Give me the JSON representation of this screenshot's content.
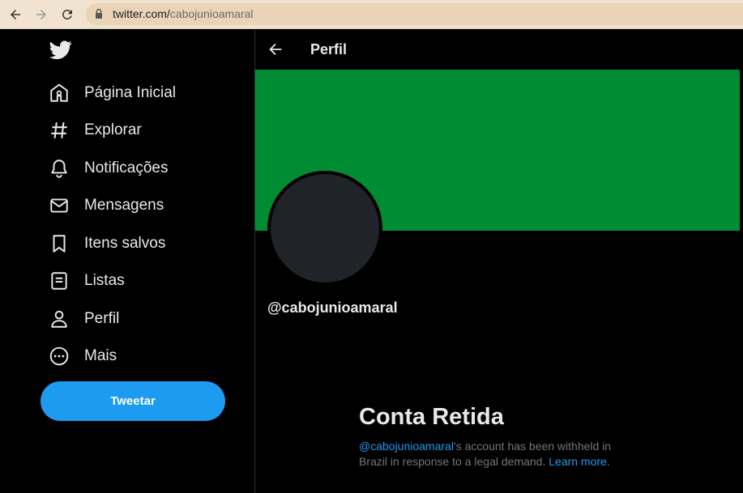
{
  "browser": {
    "url_host": "twitter.com/",
    "url_path": "cabojunioamaral"
  },
  "sidebar": {
    "items": [
      {
        "label": "Página Inicial",
        "icon": "home-icon"
      },
      {
        "label": "Explorar",
        "icon": "hashtag-icon"
      },
      {
        "label": "Notificações",
        "icon": "bell-icon"
      },
      {
        "label": "Mensagens",
        "icon": "envelope-icon"
      },
      {
        "label": "Itens salvos",
        "icon": "bookmark-icon"
      },
      {
        "label": "Listas",
        "icon": "list-icon"
      },
      {
        "label": "Perfil",
        "icon": "person-icon"
      },
      {
        "label": "Mais",
        "icon": "more-icon"
      }
    ],
    "tweet_label": "Tweetar"
  },
  "header": {
    "title": "Perfil"
  },
  "profile": {
    "handle": "@cabojunioamaral",
    "banner_color": "#008c33"
  },
  "withheld": {
    "title": "Conta Retida",
    "handle_link": "@cabojunioamaral",
    "text_middle": "'s account has been withheld in Brazil in response to a legal demand. ",
    "learn_more": "Learn more."
  },
  "colors": {
    "accent": "#1d9bf0",
    "background": "#000000"
  }
}
